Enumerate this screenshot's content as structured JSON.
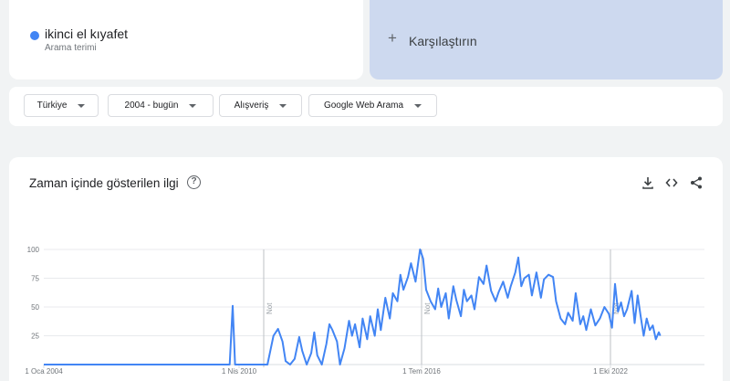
{
  "search_term": {
    "name": "ikinci el kıyafet",
    "subtitle": "Arama terimi",
    "color": "#4285f4"
  },
  "compare": {
    "label": "Karşılaştırın",
    "icon": "plus-icon"
  },
  "filters": [
    {
      "label": "Türkiye"
    },
    {
      "label": "2004 - bugün"
    },
    {
      "label": "Alışveriş"
    },
    {
      "label": "Google Web Arama"
    }
  ],
  "chart_card": {
    "title": "Zaman içinde gösterilen ilgi",
    "help_icon": "help-circle-icon",
    "actions": [
      "download-icon",
      "embed-code-icon",
      "share-icon"
    ]
  },
  "chart_data": {
    "type": "line",
    "x_ticks": [
      {
        "label": "1 Oca 2004",
        "year": 2004.0
      },
      {
        "label": "1 Nis 2010",
        "year": 2010.25
      },
      {
        "label": "1 Tem 2016",
        "year": 2016.5
      },
      {
        "label": "1 Eki 2022",
        "year": 2022.75
      }
    ],
    "y_ticks": [
      100,
      75,
      50,
      25
    ],
    "ylim": [
      0,
      100
    ],
    "xlim": [
      2004.0,
      2024.4
    ],
    "grid": true,
    "line_color": "#4285f4",
    "annotations": [
      {
        "label": "Not",
        "year": 2011.0
      },
      {
        "label": "Not",
        "year": 2016.5
      },
      {
        "label": "Not",
        "year": 2022.75
      }
    ],
    "series": [
      {
        "points": [
          [
            2004.0,
            0
          ],
          [
            2010.15,
            0
          ],
          [
            2010.25,
            51
          ],
          [
            2010.33,
            0
          ],
          [
            2011.4,
            0
          ],
          [
            2011.6,
            25
          ],
          [
            2011.75,
            31
          ],
          [
            2011.9,
            20
          ],
          [
            2012.0,
            3
          ],
          [
            2012.15,
            0
          ],
          [
            2012.3,
            5
          ],
          [
            2012.45,
            24
          ],
          [
            2012.55,
            12
          ],
          [
            2012.7,
            0
          ],
          [
            2012.85,
            10
          ],
          [
            2012.95,
            28
          ],
          [
            2013.05,
            8
          ],
          [
            2013.2,
            0
          ],
          [
            2013.35,
            18
          ],
          [
            2013.45,
            35
          ],
          [
            2013.55,
            30
          ],
          [
            2013.7,
            20
          ],
          [
            2013.8,
            0
          ],
          [
            2013.95,
            14
          ],
          [
            2014.1,
            38
          ],
          [
            2014.2,
            25
          ],
          [
            2014.3,
            35
          ],
          [
            2014.45,
            15
          ],
          [
            2014.55,
            40
          ],
          [
            2014.7,
            22
          ],
          [
            2014.8,
            42
          ],
          [
            2014.95,
            25
          ],
          [
            2015.05,
            48
          ],
          [
            2015.15,
            30
          ],
          [
            2015.3,
            58
          ],
          [
            2015.45,
            40
          ],
          [
            2015.55,
            62
          ],
          [
            2015.7,
            55
          ],
          [
            2015.8,
            78
          ],
          [
            2015.9,
            65
          ],
          [
            2016.05,
            76
          ],
          [
            2016.15,
            88
          ],
          [
            2016.3,
            72
          ],
          [
            2016.45,
            100
          ],
          [
            2016.55,
            92
          ],
          [
            2016.65,
            65
          ],
          [
            2016.8,
            55
          ],
          [
            2016.95,
            48
          ],
          [
            2017.05,
            66
          ],
          [
            2017.15,
            50
          ],
          [
            2017.3,
            62
          ],
          [
            2017.4,
            40
          ],
          [
            2017.55,
            68
          ],
          [
            2017.65,
            56
          ],
          [
            2017.8,
            42
          ],
          [
            2017.9,
            65
          ],
          [
            2018.0,
            55
          ],
          [
            2018.15,
            60
          ],
          [
            2018.25,
            48
          ],
          [
            2018.4,
            76
          ],
          [
            2018.55,
            70
          ],
          [
            2018.65,
            86
          ],
          [
            2018.8,
            64
          ],
          [
            2018.95,
            55
          ],
          [
            2019.05,
            63
          ],
          [
            2019.2,
            72
          ],
          [
            2019.35,
            58
          ],
          [
            2019.45,
            68
          ],
          [
            2019.6,
            80
          ],
          [
            2019.7,
            93
          ],
          [
            2019.8,
            68
          ],
          [
            2019.9,
            75
          ],
          [
            2020.05,
            78
          ],
          [
            2020.15,
            60
          ],
          [
            2020.3,
            80
          ],
          [
            2020.45,
            58
          ],
          [
            2020.55,
            74
          ],
          [
            2020.7,
            78
          ],
          [
            2020.85,
            76
          ],
          [
            2020.95,
            55
          ],
          [
            2021.1,
            40
          ],
          [
            2021.25,
            35
          ],
          [
            2021.35,
            45
          ],
          [
            2021.5,
            38
          ],
          [
            2021.6,
            62
          ],
          [
            2021.75,
            35
          ],
          [
            2021.85,
            42
          ],
          [
            2021.95,
            30
          ],
          [
            2022.1,
            48
          ],
          [
            2022.25,
            34
          ],
          [
            2022.4,
            40
          ],
          [
            2022.55,
            50
          ],
          [
            2022.7,
            44
          ],
          [
            2022.8,
            32
          ],
          [
            2022.9,
            70
          ],
          [
            2023.0,
            46
          ],
          [
            2023.1,
            54
          ],
          [
            2023.2,
            42
          ],
          [
            2023.3,
            48
          ],
          [
            2023.45,
            64
          ],
          [
            2023.55,
            36
          ],
          [
            2023.65,
            60
          ],
          [
            2023.75,
            42
          ],
          [
            2023.85,
            25
          ],
          [
            2023.95,
            40
          ],
          [
            2024.05,
            30
          ],
          [
            2024.15,
            34
          ],
          [
            2024.25,
            22
          ],
          [
            2024.35,
            28
          ],
          [
            2024.4,
            25
          ]
        ]
      }
    ]
  }
}
